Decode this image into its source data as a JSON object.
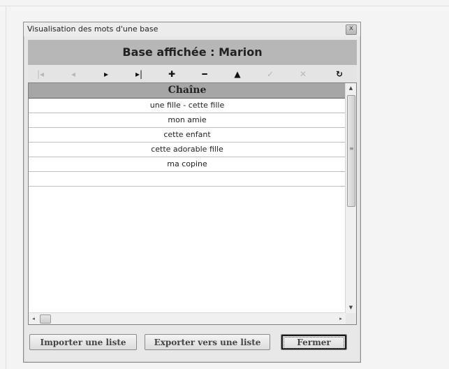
{
  "window": {
    "title": "Visualisation des mots d'une base",
    "close_glyph": "x"
  },
  "header": {
    "title": "Base affichée : Marion"
  },
  "navigator": {
    "buttons": [
      {
        "name": "first-record",
        "glyph": "|◂",
        "enabled": false
      },
      {
        "name": "prior-record",
        "glyph": "◂",
        "enabled": false
      },
      {
        "name": "next-record",
        "glyph": "▸",
        "enabled": true
      },
      {
        "name": "last-record",
        "glyph": "▸|",
        "enabled": true
      },
      {
        "name": "insert-record",
        "glyph": "✚",
        "enabled": true
      },
      {
        "name": "delete-record",
        "glyph": "━",
        "enabled": true
      },
      {
        "name": "edit-record",
        "glyph": "▲",
        "enabled": true
      },
      {
        "name": "post-edit",
        "glyph": "✓",
        "enabled": false
      },
      {
        "name": "cancel-edit",
        "glyph": "✕",
        "enabled": false
      },
      {
        "name": "refresh-data",
        "glyph": "↻",
        "enabled": true
      }
    ]
  },
  "grid": {
    "column_header": "Chaîne",
    "rows": [
      "une fille - cette fille",
      "mon amie",
      "cette enfant",
      "cette adorable fille",
      "ma copine",
      ""
    ],
    "vscroll": {
      "up": "▲",
      "down": "▼",
      "grip": "≡"
    },
    "hscroll": {
      "left": "◂",
      "right": "▸"
    }
  },
  "buttons": {
    "import": "Importer une liste",
    "export": "Exporter vers une liste",
    "close": "Fermer"
  }
}
